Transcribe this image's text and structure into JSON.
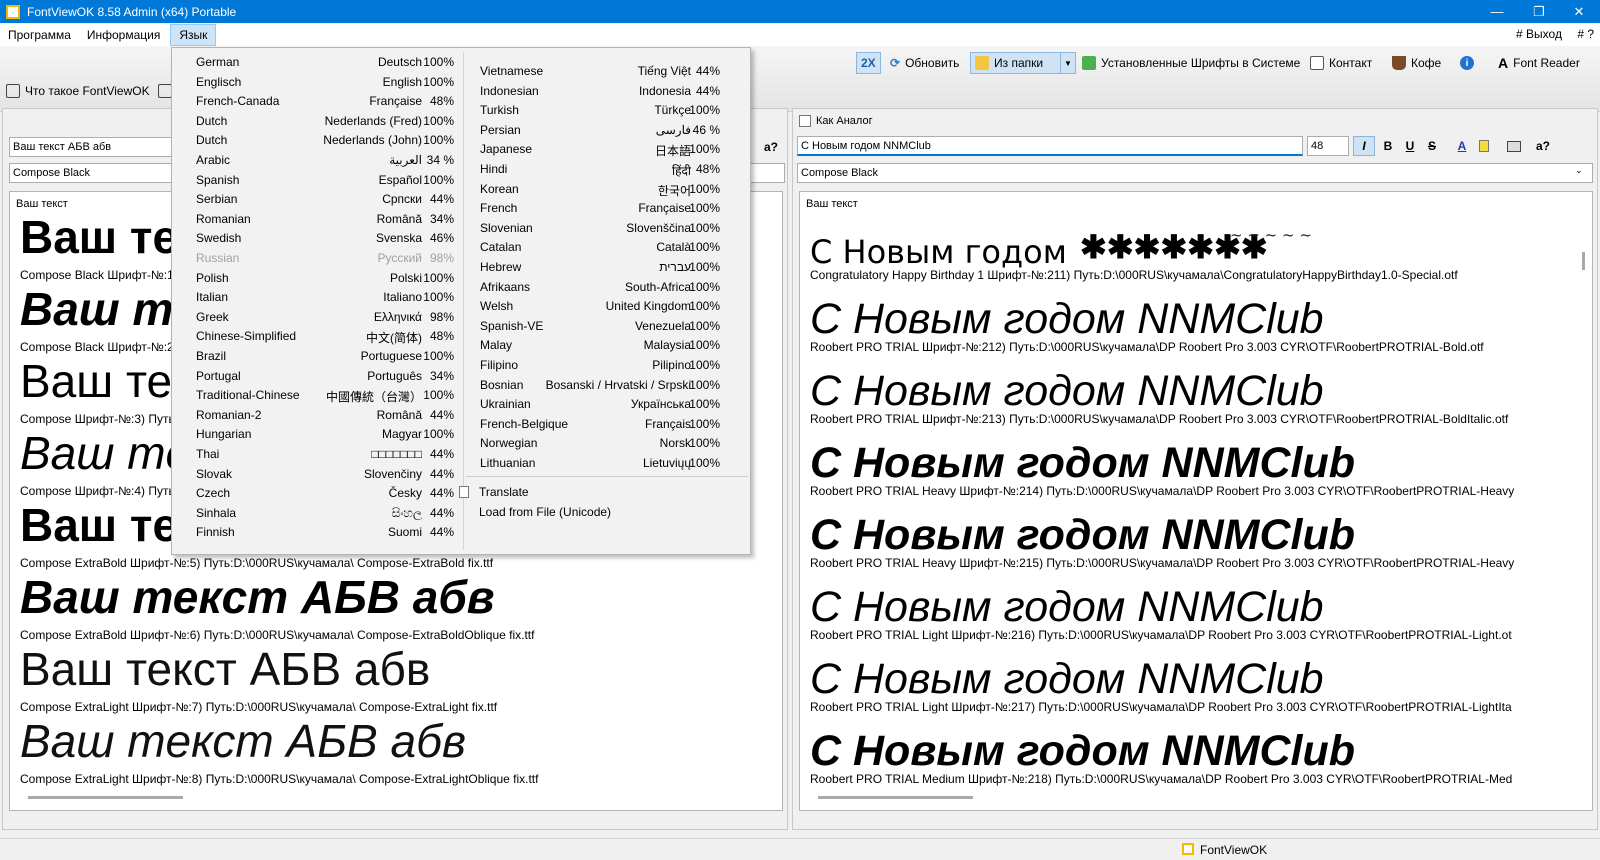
{
  "window": {
    "title": "FontViewOK 8.58 Admin (x64) Portable",
    "minimize": "—",
    "maximize": "❐",
    "close": "✕"
  },
  "menu": {
    "items": [
      "Программа",
      "Информация",
      "Язык"
    ],
    "exit": "# Выход",
    "help": "# ?"
  },
  "toolbar": {
    "zoom": "2X",
    "refresh": "Обновить",
    "from_folder": "Из папки",
    "installed": "Установленные Шрифты в Системе",
    "contact": "Контакт",
    "coffee": "Кофе",
    "font_reader": "Font Reader",
    "what_is": "Что такое FontViewOK"
  },
  "left": {
    "text_input": "Ваш текст АБВ абв",
    "font_select": "Compose Black",
    "help": "a?",
    "caption": "Ваш текст",
    "entries": [
      {
        "sample": "Ваш текст АБВ абв",
        "info": "Compose Black Шрифт-№:1) Путь:D:\\000RUS\\кучамала\\ Compose-Black fix.ttf"
      },
      {
        "sample": "Ваш текст АБВ абв",
        "info": "Compose Black Шрифт-№:2) Путь:D:\\000RUS\\кучамала\\ Compose-BlackOblique fix.ttf"
      },
      {
        "sample": "Ваш текст АБВ абв",
        "info": "Compose Шрифт-№:3) Путь:D:\\000RUS\\кучамала\\ Compose fix.ttf"
      },
      {
        "sample": "Ваш текст АБВ абв",
        "info": "Compose Шрифт-№:4) Путь:D:\\000RUS\\кучамала\\ Compose-Oblique fix.ttf"
      },
      {
        "sample": "Ваш текст АБВ абв",
        "info": "Compose ExtraBold Шрифт-№:5) Путь:D:\\000RUS\\кучамала\\ Compose-ExtraBold fix.ttf"
      },
      {
        "sample": "Ваш текст АБВ абв",
        "info": "Compose ExtraBold Шрифт-№:6) Путь:D:\\000RUS\\кучамала\\ Compose-ExtraBoldOblique fix.ttf"
      },
      {
        "sample": "Ваш текст АБВ абв",
        "info": "Compose ExtraLight Шрифт-№:7) Путь:D:\\000RUS\\кучамала\\ Compose-ExtraLight fix.ttf"
      },
      {
        "sample": "Ваш текст АБВ абв",
        "info": "Compose ExtraLight Шрифт-№:8) Путь:D:\\000RUS\\кучамала\\ Compose-ExtraLightOblique fix.ttf"
      }
    ]
  },
  "right": {
    "analog_label": "Как Аналог",
    "text_input": "С Новым годом NNMClub",
    "size": "48",
    "font_select": "Compose Black",
    "caption": "Ваш текст",
    "help": "a?",
    "format_buttons": [
      "I",
      "B",
      "U",
      "S",
      "A"
    ],
    "entries": [
      {
        "sample": "С Новым годом",
        "info": "Congratulatory Happy Birthday 1 Шрифт-№:211) Путь:D:\\000RUS\\кучамала\\CongratulatoryHappyBirthday1.0-Special.otf"
      },
      {
        "sample": "С Новым годом NNMClub",
        "info": "Roobert PRO TRIAL Шрифт-№:212) Путь:D:\\000RUS\\кучамала\\DP Roobert Pro 3.003 CYR\\OTF\\RoobertPROTRIAL-Bold.otf"
      },
      {
        "sample": "С Новым годом NNMClub",
        "info": "Roobert PRO TRIAL Шрифт-№:213) Путь:D:\\000RUS\\кучамала\\DP Roobert Pro 3.003 CYR\\OTF\\RoobertPROTRIAL-BoldItalic.otf"
      },
      {
        "sample": "С Новым годом NNMClub",
        "info": "Roobert PRO TRIAL Heavy Шрифт-№:214) Путь:D:\\000RUS\\кучамала\\DP Roobert Pro 3.003 CYR\\OTF\\RoobertPROTRIAL-Heavy"
      },
      {
        "sample": "С Новым годом NNMClub",
        "info": "Roobert PRO TRIAL Heavy Шрифт-№:215) Путь:D:\\000RUS\\кучамала\\DP Roobert Pro 3.003 CYR\\OTF\\RoobertPROTRIAL-Heavy"
      },
      {
        "sample": "С Новым годом NNMClub",
        "info": "Roobert PRO TRIAL Light Шрифт-№:216) Путь:D:\\000RUS\\кучамала\\DP Roobert Pro 3.003 CYR\\OTF\\RoobertPROTRIAL-Light.ot"
      },
      {
        "sample": "С Новым годом NNMClub",
        "info": "Roobert PRO TRIAL Light Шрифт-№:217) Путь:D:\\000RUS\\кучамала\\DP Roobert Pro 3.003 CYR\\OTF\\RoobertPROTRIAL-LightIta"
      },
      {
        "sample": "С Новым годом NNMClub",
        "info": "Roobert PRO TRIAL Medium Шрифт-№:218) Путь:D:\\000RUS\\кучамала\\DP Roobert Pro 3.003 CYR\\OTF\\RoobertPROTRIAL-Med"
      }
    ]
  },
  "language_menu": {
    "col1": [
      {
        "name": "German",
        "native": "Deutsch",
        "pct": "100%"
      },
      {
        "name": "Englisch",
        "native": "English",
        "pct": "100%"
      },
      {
        "name": "French-Canada",
        "native": "Française",
        "pct": "48%"
      },
      {
        "name": "Dutch",
        "native": "Nederlands (Fred)",
        "pct": "100%"
      },
      {
        "name": "Dutch",
        "native": "Nederlands (John)",
        "pct": "100%"
      },
      {
        "name": "Arabic",
        "native": "العربية",
        "pct": "34 %"
      },
      {
        "name": "Spanish",
        "native": "Español",
        "pct": "100%"
      },
      {
        "name": "Serbian",
        "native": "Српски",
        "pct": "44%"
      },
      {
        "name": "Romanian",
        "native": "Română",
        "pct": "34%"
      },
      {
        "name": "Swedish",
        "native": "Svenska",
        "pct": "46%"
      },
      {
        "name": "Russian",
        "native": "Русский",
        "pct": "98%",
        "disabled": true
      },
      {
        "name": "Polish",
        "native": "Polski",
        "pct": "100%"
      },
      {
        "name": "Italian",
        "native": "Italiano",
        "pct": "100%"
      },
      {
        "name": "Greek",
        "native": "Ελληνικά",
        "pct": "98%"
      },
      {
        "name": "Chinese-Simplified",
        "native": "中文(简体)",
        "pct": "48%"
      },
      {
        "name": "Brazil",
        "native": "Portuguese",
        "pct": "100%"
      },
      {
        "name": "Portugal",
        "native": "Português",
        "pct": "34%"
      },
      {
        "name": "Traditional-Chinese",
        "native": "中國傳統（台灣）",
        "pct": "100%"
      },
      {
        "name": "Romanian-2",
        "native": "Română",
        "pct": "44%"
      },
      {
        "name": "Hungarian",
        "native": "Magyar",
        "pct": "100%"
      },
      {
        "name": "Thai",
        "native": "□□□□□□□",
        "pct": "44%"
      },
      {
        "name": "Slovak",
        "native": "Slovenčiny",
        "pct": "44%"
      },
      {
        "name": "Czech",
        "native": "Česky",
        "pct": "44%"
      },
      {
        "name": "Sinhala",
        "native": "සිංහල",
        "pct": "44%"
      },
      {
        "name": "Finnish",
        "native": "Suomi",
        "pct": "44%"
      }
    ],
    "col2": [
      {
        "name": "Vietnamese",
        "native": "Tiếng Việt",
        "pct": "44%"
      },
      {
        "name": "Indonesian",
        "native": "Indonesia",
        "pct": "44%"
      },
      {
        "name": "Turkish",
        "native": "Türkçe",
        "pct": "100%"
      },
      {
        "name": "Persian",
        "native": "فارسی",
        "pct": "46 %"
      },
      {
        "name": "Japanese",
        "native": "日本語",
        "pct": "100%"
      },
      {
        "name": "Hindi",
        "native": "हिंदी",
        "pct": "48%"
      },
      {
        "name": "Korean",
        "native": "한국어",
        "pct": "100%"
      },
      {
        "name": "French",
        "native": "Française",
        "pct": "100%"
      },
      {
        "name": "Slovenian",
        "native": "Slovenščina",
        "pct": "100%"
      },
      {
        "name": "Catalan",
        "native": "Català",
        "pct": "100%"
      },
      {
        "name": "Hebrew",
        "native": "עברית",
        "pct": "100%"
      },
      {
        "name": "Afrikaans",
        "native": "South-Africa",
        "pct": "100%"
      },
      {
        "name": "Welsh",
        "native": "United Kingdom",
        "pct": "100%"
      },
      {
        "name": "Spanish-VE",
        "native": "Venezuela",
        "pct": "100%"
      },
      {
        "name": "Malay",
        "native": "Malaysia",
        "pct": "100%"
      },
      {
        "name": "Filipino",
        "native": "Pilipino",
        "pct": "100%"
      },
      {
        "name": "Bosnian",
        "native": "Bosanski / Hrvatski / Srpski",
        "pct": "100%"
      },
      {
        "name": "Ukrainian",
        "native": "Українська",
        "pct": "100%"
      },
      {
        "name": "French-Belgique",
        "native": "Français",
        "pct": "100%"
      },
      {
        "name": "Norwegian",
        "native": "Norsk",
        "pct": "100%"
      },
      {
        "name": "Lithuanian",
        "native": "Lietuviųų",
        "pct": "100%"
      }
    ],
    "translate": "Translate",
    "load_file": "Load from File (Unicode)"
  },
  "statusbar": {
    "app": "FontViewOK"
  }
}
